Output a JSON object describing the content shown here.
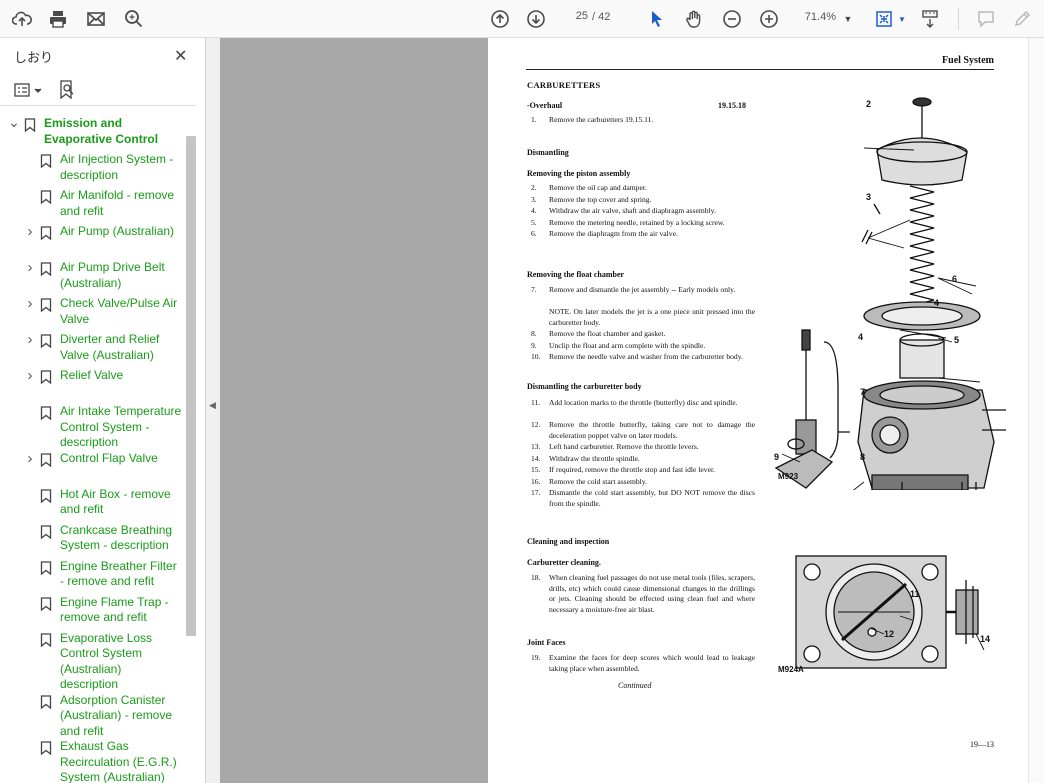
{
  "toolbar": {
    "current_page": "25",
    "page_separator": "/",
    "total_pages": "42",
    "zoom": "71.4%"
  },
  "sidebar": {
    "title": "しおり",
    "items": [
      {
        "label": "Emission and Evaporative Control",
        "top": true,
        "chevron": "v"
      },
      {
        "label": "Air Injection System - description"
      },
      {
        "label": "Air Manifold - remove and refit"
      },
      {
        "label": "Air Pump (Australian)",
        "chevron": ">"
      },
      {
        "label": "Air Pump Drive Belt (Australian)",
        "chevron": ">"
      },
      {
        "label": "Check Valve/Pulse Air Valve",
        "chevron": ">"
      },
      {
        "label": "Diverter and Relief Valve (Australian)",
        "chevron": ">"
      },
      {
        "label": "Relief Valve",
        "chevron": ">"
      },
      {
        "label": "Air Intake Temperature Control System - description"
      },
      {
        "label": "Control Flap Valve",
        "chevron": ">"
      },
      {
        "label": "Hot Air Box - remove and refit"
      },
      {
        "label": "Crankcase Breathing System - description"
      },
      {
        "label": "Engine Breather Filter - remove and refit"
      },
      {
        "label": "Engine Flame Trap - remove and refit"
      },
      {
        "label": "Evaporative Loss Control System (Australian) description"
      },
      {
        "label": "Adsorption Canister (Australian) - remove and refit"
      },
      {
        "label": "Exhaust Gas Recirculation (E.G.R.) System (Australian) description"
      }
    ]
  },
  "document": {
    "header": "Fuel System",
    "section_title": "CARBURETTERS",
    "overhaul_label": "-Overhaul",
    "overhaul_code": "19.15.18",
    "overhaul_steps": [
      {
        "n": "1.",
        "t": "Remove the carburetters 19.15.11."
      }
    ],
    "dismantling": "Dismantling",
    "piston_heading": "Removing the piston assembly",
    "piston_steps": [
      {
        "n": "2.",
        "t": "Remove the oil cap and damper."
      },
      {
        "n": "3.",
        "t": "Remove the top cover and spring."
      },
      {
        "n": "4.",
        "t": "Withdraw the air valve, shaft and diaphragm assembly."
      },
      {
        "n": "5.",
        "t": "Remove the metering needle, retained by a locking screw."
      },
      {
        "n": "6.",
        "t": "Remove the diaphragm from the air valve."
      }
    ],
    "float_heading": "Removing the float chamber",
    "float_steps": [
      {
        "n": "7.",
        "t": "Remove and dismantle the jet assembly -- Early models only."
      },
      {
        "n": "",
        "t": "NOTE. On later models the jet is a one piece unit pressed into the carburetter body."
      },
      {
        "n": "8.",
        "t": "Remove the float chamber and gasket."
      },
      {
        "n": "9.",
        "t": "Unclip the float and arm complete with the spindle."
      },
      {
        "n": "10.",
        "t": "Remove the needle valve and washer from the carburetter body."
      }
    ],
    "body_heading": "Dismantling the carburetter body",
    "body_steps": [
      {
        "n": "11.",
        "t": "Add location marks to the throttle (butterfly) disc and spindle."
      },
      {
        "n": "12.",
        "t": "Remove the throttle butterfly, taking care not to damage the deceleration poppet valve on later models."
      },
      {
        "n": "13.",
        "t": "Left hand carburetter. Remove the throttle levers."
      },
      {
        "n": "14.",
        "t": "Withdraw the throttle spindle."
      },
      {
        "n": "15.",
        "t": "If required, remove the throttle stop and fast idle lever."
      },
      {
        "n": "16.",
        "t": "Remove the cold start assembly."
      },
      {
        "n": "17.",
        "t": "Dismantle the cold start assembly, but DO NOT remove the discs from the spindle."
      }
    ],
    "cleaning_heading": "Cleaning and inspection",
    "carb_cleaning_heading": "Carburetter cleaning.",
    "cleaning_steps": [
      {
        "n": "18.",
        "t": "When cleaning fuel passages do not use metal tools (files, scrapers, drills, etc) which could cause dimensional changes in the drillings or jets. Cleaning should be effected using clean fuel and where necessary a moisture-free air blast."
      }
    ],
    "joint_heading": "Joint Faces",
    "joint_steps": [
      {
        "n": "19.",
        "t": "Examine the faces for deep scores which would lead to leakage taking place when assembled."
      }
    ],
    "continued": "Continued",
    "page_number": "19—13",
    "fig1_callouts": [
      "2",
      "3",
      "4",
      "4",
      "5",
      "6",
      "7",
      "8",
      "9"
    ],
    "fig1_code": "M923",
    "fig2_callouts": [
      "11",
      "12",
      "14"
    ],
    "fig2_code": "M924A"
  }
}
